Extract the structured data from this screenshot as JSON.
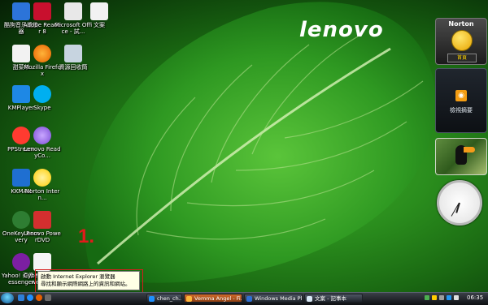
{
  "desktop": {
    "icons": [
      {
        "id": "icon-1",
        "label": "酷狗音乐播放器",
        "icon": "music-file-icon",
        "color": "#2c74d9"
      },
      {
        "id": "icon-2",
        "label": "Adobe Reader 8",
        "icon": "adobe-reader-icon",
        "color": "#c8102e"
      },
      {
        "id": "icon-3",
        "label": "Microsoft Office - 試...",
        "icon": "office-icon",
        "color": "#e8e8e8"
      },
      {
        "id": "icon-4",
        "label": "文案",
        "icon": "document-icon",
        "color": "#f2f2f2"
      },
      {
        "id": "icon-5",
        "label": "甜菜单",
        "icon": "document-icon",
        "color": "#f2f2f2"
      },
      {
        "id": "icon-6",
        "label": "Mozilla Firefox",
        "icon": "firefox-icon",
        "color": "#e66000"
      },
      {
        "id": "icon-7",
        "label": "資源回收筒",
        "icon": "recycle-bin-icon",
        "color": "#c7d4e0"
      },
      {
        "id": "icon-8",
        "label": "KMPlayer",
        "icon": "kmplayer-icon",
        "color": "#1e88e5"
      },
      {
        "id": "icon-9",
        "label": "Skype",
        "icon": "skype-icon",
        "color": "#00aff0"
      },
      {
        "id": "icon-10",
        "label": "PPStream",
        "icon": "ppstream-icon",
        "color": "#ff3b30"
      },
      {
        "id": "icon-11",
        "label": "Lenovo ReadyCo...",
        "icon": "lenovo-ready-icon",
        "color": "#7a4bd6"
      },
      {
        "id": "icon-12",
        "label": "KKMAN",
        "icon": "kkman-icon",
        "color": "#1f6fd1"
      },
      {
        "id": "icon-13",
        "label": "Norton Intern...",
        "icon": "norton-icon",
        "color": "#ffcc00"
      },
      {
        "id": "icon-14",
        "label": "OneKey Recovery",
        "icon": "onekey-icon",
        "color": "#2e7d32"
      },
      {
        "id": "icon-15",
        "label": "Lenovo PowerDVD",
        "icon": "powerdvd-icon",
        "color": "#d32f2f"
      },
      {
        "id": "icon-16",
        "label": "Yahoo! 奇摩 Messenger",
        "icon": "yahoo-messenger-icon",
        "color": "#7b1fa2"
      },
      {
        "id": "icon-17",
        "label": "CyberLink Power2Go",
        "icon": "power2go-icon",
        "color": "#f5f5f5"
      }
    ]
  },
  "brand": {
    "text": "lenovo"
  },
  "gadgets": {
    "norton": {
      "title": "Norton",
      "button": "首頁"
    },
    "feed": {
      "label": "檢視摘要"
    },
    "photo": {
      "icon": "toucan-photo"
    },
    "clock": {
      "hour": 6,
      "minute": 35
    }
  },
  "annotation": {
    "step": "1."
  },
  "tooltip": {
    "line1": "啟動 Internet Explorer 瀏覽器",
    "line2": "尋找和顯示網際網路上的資訊和網站。"
  },
  "taskbar": {
    "buttons": [
      {
        "label": "chen_ch...",
        "active": false,
        "icon": "ie-icon"
      },
      {
        "label": "Vemma Angel - Fi...",
        "active": true,
        "icon": "firefox-icon"
      },
      {
        "label": "Windows Media Pl...",
        "active": false,
        "icon": "media-player-icon"
      },
      {
        "label": "文案 - 記事本",
        "active": false,
        "icon": "notepad-icon"
      }
    ],
    "time": "06:35"
  },
  "colors": {
    "annotation_red": "#e11a1a",
    "accent_orange": "#d06a2a"
  }
}
